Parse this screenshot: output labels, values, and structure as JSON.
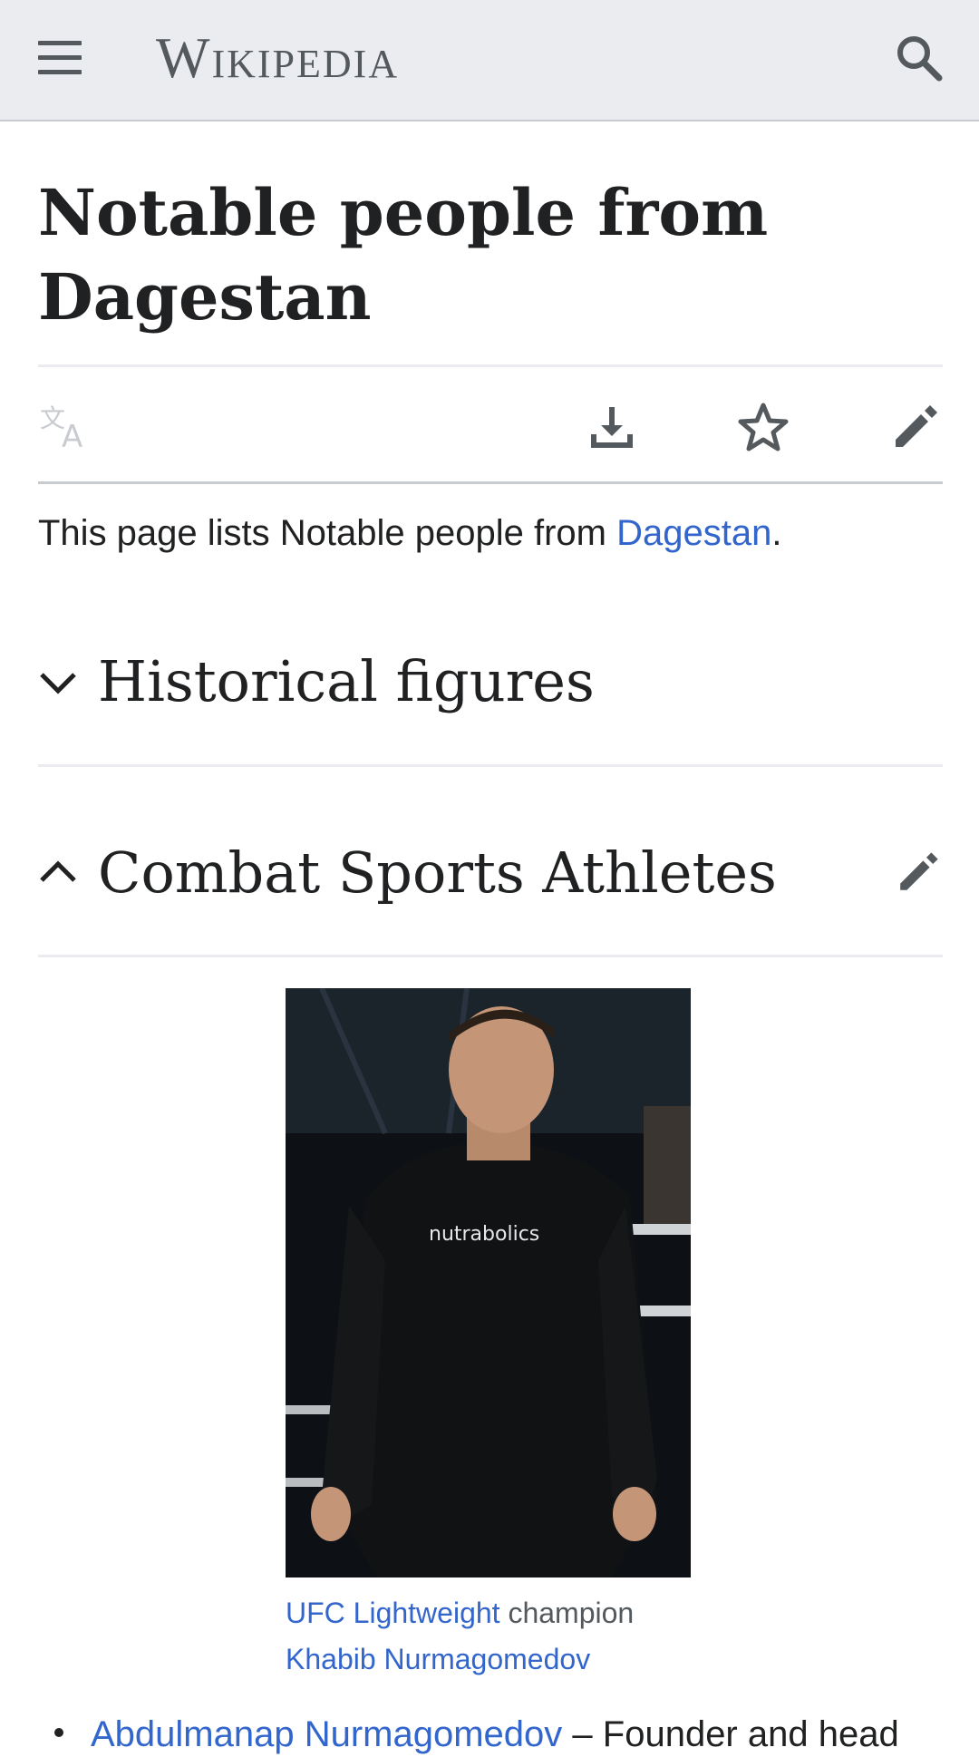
{
  "header": {
    "wordmark": "Wikipedia",
    "menu_icon": "hamburger-menu-icon",
    "search_icon": "search-icon"
  },
  "page": {
    "title_line1": "Notable people from",
    "title_line2": "Dagestan"
  },
  "page_actions": {
    "language_icon": "language-icon",
    "download_icon": "download-icon",
    "watch_icon": "star-icon",
    "edit_icon": "edit-pencil-icon"
  },
  "intro": {
    "prefix": "This page lists Notable people from ",
    "link": "Dagestan",
    "suffix": "."
  },
  "sections": [
    {
      "title": "Historical figures",
      "state": "collapsed",
      "icon": "chevron-down-icon"
    },
    {
      "title": "Combat Sports Athletes",
      "state": "expanded",
      "icon": "chevron-up-icon",
      "edit_icon": "edit-pencil-icon"
    }
  ],
  "figure": {
    "shirt_text": "nutrabolics",
    "caption_link1": "UFC Lightweight",
    "caption_text": " champion",
    "caption_link2": "Khabib Nurmagomedov"
  },
  "list": [
    {
      "link": "Abdulmanap Nurmagomedov",
      "text": " – Founder and head"
    }
  ],
  "colors": {
    "header_bg": "#eaecf0",
    "link": "#3366cc",
    "text": "#202122",
    "icon": "#54595d"
  }
}
